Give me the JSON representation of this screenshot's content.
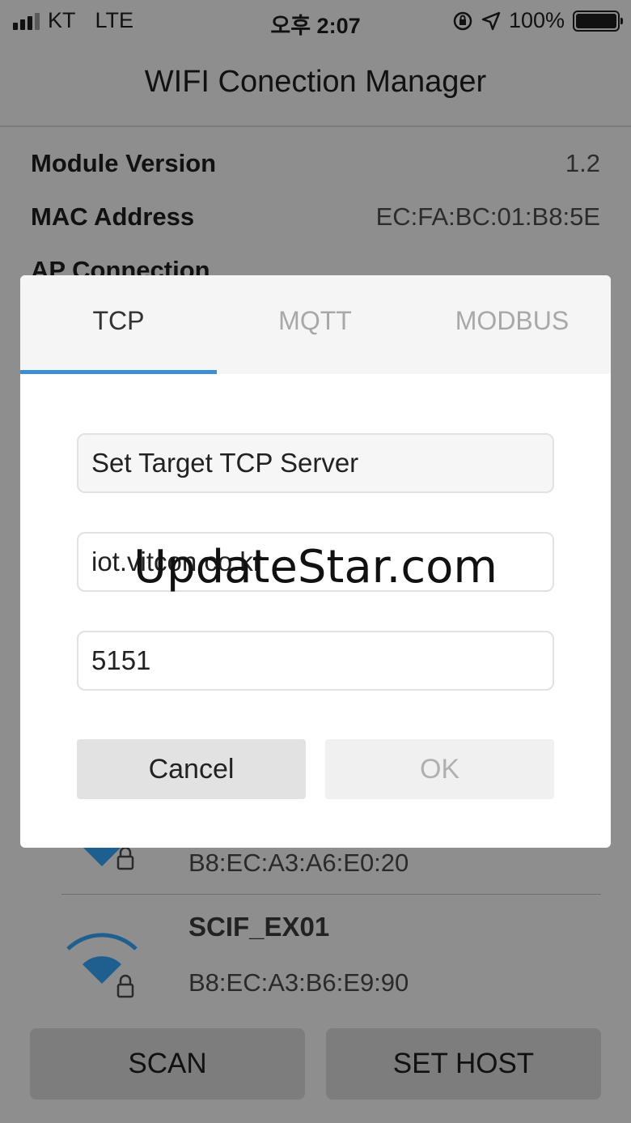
{
  "status_bar": {
    "carrier": "KT",
    "network": "LTE",
    "time": "오후 2:07",
    "battery": "100%",
    "signal_bars_filled": 3,
    "signal_bars_total": 4,
    "icons": [
      "rotation-lock-icon",
      "location-arrow-icon",
      "battery-icon"
    ]
  },
  "header": {
    "title": "WIFI Conection Manager"
  },
  "module_info": [
    {
      "label": "Module Version",
      "value": "1.2"
    },
    {
      "label": "MAC Address",
      "value": "EC:FA:BC:01:B8:5E"
    },
    {
      "label": "AP Connection",
      "value": ""
    }
  ],
  "networks": [
    {
      "ssid": "",
      "mac": "B8:EC:A3:A6:E0:20",
      "icon": "wifi-lock-icon"
    },
    {
      "ssid": "SCIF_EX01",
      "mac": "B8:EC:A3:B6:E9:90",
      "icon": "wifi-lock-icon"
    }
  ],
  "bottom_buttons": {
    "scan": "SCAN",
    "set_host": "SET HOST"
  },
  "dialog": {
    "tabs": [
      "TCP",
      "MQTT",
      "MODBUS"
    ],
    "active_tab": "TCP",
    "section_title": "Set Target TCP Server",
    "host_value": "iot.vitcon.co.kr",
    "port_value": "5151",
    "cancel_label": "Cancel",
    "ok_label": "OK"
  },
  "watermark": "UpdateStar.com",
  "colors": {
    "accent": "#3d8fd4",
    "wifi_icon": "#1f5f8f",
    "overlay": "#8e8e8e"
  }
}
